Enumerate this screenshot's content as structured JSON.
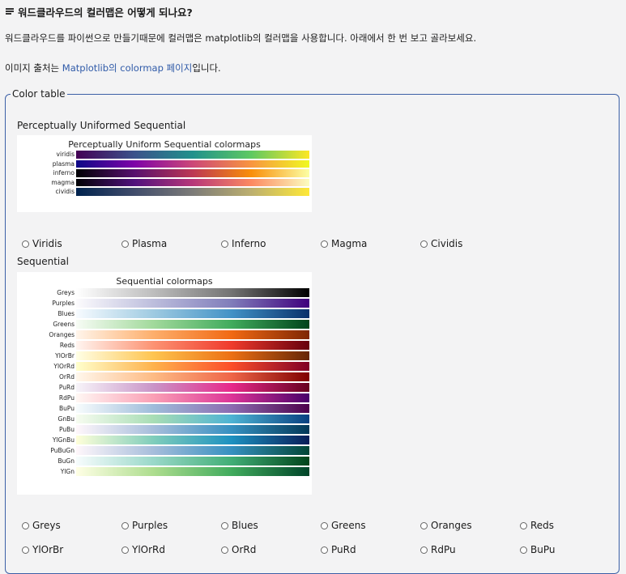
{
  "question": {
    "title": "워드클라우드의 컬러맵은 어떻게 되나요?"
  },
  "description": "워드클라우드를 파이썬으로 만들기때문에 컬러맵은 matplotlib의 컬러맵을 사용합니다. 아래에서 한 번 보고 골라보세요.",
  "source": {
    "prefix": "이미지 출처는 ",
    "link": "Matplotlib의 colormap 페이지",
    "suffix": "입니다."
  },
  "colors": {
    "accent": "#3b5fa6",
    "link": "#2f5aa8"
  },
  "color_table": {
    "legend": "Color table",
    "sections": [
      {
        "title": "Perceptually Uniformed Sequential",
        "figure": {
          "title": "Perceptually Uniform Sequential colormaps",
          "colormaps": [
            {
              "name": "viridis",
              "stops": [
                "#440154",
                "#3b528b",
                "#21918c",
                "#5ec962",
                "#fde725"
              ]
            },
            {
              "name": "plasma",
              "stops": [
                "#0d0887",
                "#7e03a8",
                "#cc4778",
                "#f89540",
                "#f0f921"
              ]
            },
            {
              "name": "inferno",
              "stops": [
                "#000004",
                "#57106e",
                "#bc3754",
                "#f98e09",
                "#fcffa4"
              ]
            },
            {
              "name": "magma",
              "stops": [
                "#000004",
                "#51127c",
                "#b73779",
                "#fc8961",
                "#fcfdbf"
              ]
            },
            {
              "name": "cividis",
              "stops": [
                "#00224e",
                "#414d6b",
                "#7c7b78",
                "#bcaf6f",
                "#fee838"
              ]
            }
          ]
        },
        "options": [
          [
            "Viridis",
            "Plasma",
            "Inferno",
            "Magma",
            "Cividis"
          ]
        ]
      },
      {
        "title": "Sequential",
        "figure": {
          "title": "Sequential colormaps",
          "colormaps": [
            {
              "name": "Greys",
              "stops": [
                "#ffffff",
                "#bdbdbd",
                "#737373",
                "#000000"
              ]
            },
            {
              "name": "Purples",
              "stops": [
                "#fcfbfd",
                "#bcbddc",
                "#807dba",
                "#3f007d"
              ]
            },
            {
              "name": "Blues",
              "stops": [
                "#f7fbff",
                "#9ecae1",
                "#4292c6",
                "#08306b"
              ]
            },
            {
              "name": "Greens",
              "stops": [
                "#f7fcf5",
                "#a1d99b",
                "#41ab5d",
                "#00441b"
              ]
            },
            {
              "name": "Oranges",
              "stops": [
                "#fff5eb",
                "#fdae6b",
                "#f16913",
                "#7f2704"
              ]
            },
            {
              "name": "Reds",
              "stops": [
                "#fff5f0",
                "#fc9272",
                "#ef3b2c",
                "#67000d"
              ]
            },
            {
              "name": "YlOrBr",
              "stops": [
                "#ffffe5",
                "#fec44f",
                "#ec7014",
                "#662506"
              ]
            },
            {
              "name": "YlOrRd",
              "stops": [
                "#ffffcc",
                "#feb24c",
                "#fc4e2a",
                "#800026"
              ]
            },
            {
              "name": "OrRd",
              "stops": [
                "#fff7ec",
                "#fdbb84",
                "#ef6548",
                "#7f0000"
              ]
            },
            {
              "name": "PuRd",
              "stops": [
                "#f7f4f9",
                "#c994c7",
                "#e7298a",
                "#67001f"
              ]
            },
            {
              "name": "RdPu",
              "stops": [
                "#fff7f3",
                "#fa9fb5",
                "#dd3497",
                "#49006a"
              ]
            },
            {
              "name": "BuPu",
              "stops": [
                "#f7fcfd",
                "#9ebcda",
                "#8c6bb1",
                "#4d004b"
              ]
            },
            {
              "name": "GnBu",
              "stops": [
                "#f7fcf0",
                "#a8ddb5",
                "#4eb3d3",
                "#084081"
              ]
            },
            {
              "name": "PuBu",
              "stops": [
                "#fff7fb",
                "#a6bddb",
                "#3690c0",
                "#023858"
              ]
            },
            {
              "name": "YlGnBu",
              "stops": [
                "#ffffd9",
                "#7fcdbb",
                "#1d91c0",
                "#081d58"
              ]
            },
            {
              "name": "PuBuGn",
              "stops": [
                "#fff7fb",
                "#a6bddb",
                "#3690c0",
                "#014636"
              ]
            },
            {
              "name": "BuGn",
              "stops": [
                "#f7fcfd",
                "#99d8c9",
                "#41ae76",
                "#00441b"
              ]
            },
            {
              "name": "YlGn",
              "stops": [
                "#ffffe5",
                "#addd8e",
                "#41ab5d",
                "#004529"
              ]
            }
          ]
        },
        "options": [
          [
            "Greys",
            "Purples",
            "Blues",
            "Greens",
            "Oranges",
            "Reds"
          ],
          [
            "YlOrBr",
            "YlOrRd",
            "OrRd",
            "PuRd",
            "RdPu",
            "BuPu"
          ]
        ]
      }
    ]
  }
}
